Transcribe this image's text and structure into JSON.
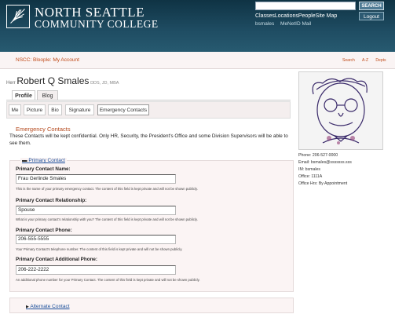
{
  "header": {
    "title_line1": "NORTH SEATTLE",
    "title_line2": "COMMUNITY COLLEGE",
    "search_button": "SEARCH",
    "top_links": "ClassesLocationsPeopleSite Map",
    "user": "bsmales",
    "meNetId": "MeNetID Mail",
    "logout": "Logout"
  },
  "subbar": {
    "breadcrumb": "NSCC: Bloople: My Account",
    "right_nav": [
      "Search",
      "A-Z",
      "Depts"
    ]
  },
  "person": {
    "prefix": "Herr",
    "name": "Robert Q Smales",
    "suffix": "DDS, JD, MBA"
  },
  "tabs": [
    "Profile",
    "Blog"
  ],
  "subtabs": [
    "Me",
    "Picture",
    "Bio",
    "Signature",
    "Emergency Contacts"
  ],
  "section": {
    "title": "Emergency Contacts",
    "description": "These Contacts will be kept confidential. Only HR, Security, the President's Office and some Division Supervisors will be able to see them."
  },
  "primary": {
    "legend": "Primary Contact",
    "fields": [
      {
        "label": "Primary Contact Name:",
        "value": "Frau Gerlinde Smales",
        "help": "This is the name of your primary emergency contact. The content of this field is kept private and will not be shown publicly."
      },
      {
        "label": "Primary Contact Relationship:",
        "value": "Spouse",
        "help": "What is your primary contact's relationship with you? The content of this field is kept private and will not be shown publicly."
      },
      {
        "label": "Primary Contact Phone:",
        "value": "206-555-5555",
        "help": "Your Primary Contact's telephone number. The content of this field is kept private and will not be shown publicly."
      },
      {
        "label": "Primary Contact Additional Phone:",
        "value": "206-222-2222",
        "help": "An additional phone number for your Primary Contact. The content of this field is kept private and will not be shown publicly."
      }
    ]
  },
  "alternate": {
    "legend": "Alternate Contact"
  },
  "sidebar": {
    "phone": "Phone: 206-527-0000",
    "email": "Email: bsmales@sssssss.sss",
    "im": "IM: bsmales",
    "office": "Office: 1111A",
    "hours": "Office Hrs: By Appointment"
  }
}
